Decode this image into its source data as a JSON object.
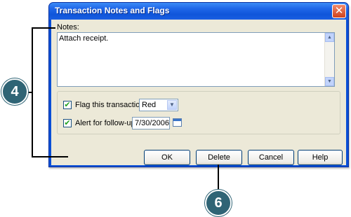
{
  "window": {
    "title": "Transaction Notes and Flags",
    "close_glyph": "✕"
  },
  "notes": {
    "label": "Notes:",
    "value": "Attach receipt."
  },
  "flag": {
    "checked": true,
    "label": "Flag this transaction:",
    "selected": "Red"
  },
  "alert": {
    "checked": true,
    "label": "Alert for follow-up on:",
    "date": "7/30/2006"
  },
  "buttons": {
    "ok": "OK",
    "delete": "Delete",
    "cancel": "Cancel",
    "help": "Help"
  },
  "callouts": {
    "first": "4",
    "second": "6"
  },
  "icons": {
    "check": "✔",
    "dropdown": "▼",
    "scroll_up": "▲",
    "scroll_down": "▼"
  },
  "colors": {
    "title_bar": "#0f55da",
    "dialog_bg": "#ece9d8",
    "close_button": "#d0421e",
    "callout_circle": "#2f6475"
  }
}
